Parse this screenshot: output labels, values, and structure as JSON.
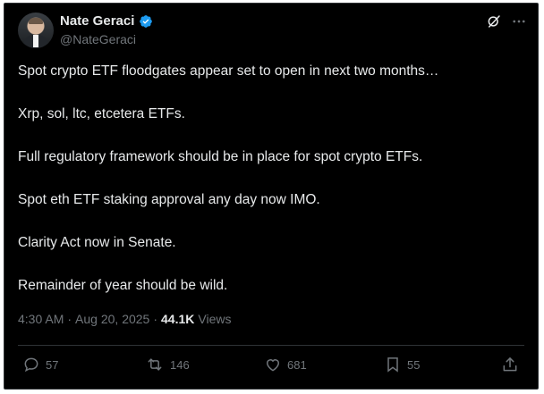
{
  "author": {
    "name": "Nate Geraci",
    "handle": "@NateGeraci"
  },
  "tweet": {
    "lines": [
      "Spot crypto ETF floodgates appear set to open in next two months…",
      "Xrp, sol, ltc, etcetera ETFs.",
      "Full regulatory framework should be in place for spot crypto ETFs.",
      "Spot eth ETF staking approval any day now IMO.",
      "Clarity Act now in Senate.",
      "Remainder of year should be wild."
    ],
    "time": "4:30 AM",
    "separator": "·",
    "date": "Aug 20, 2025",
    "views_count": "44.1K",
    "views_label": "Views"
  },
  "actions": {
    "replies": "57",
    "reposts": "146",
    "likes": "681",
    "bookmarks": "55"
  },
  "colors": {
    "background": "#000000",
    "text": "#e7e9ea",
    "muted": "#71767b",
    "verified": "#1d9bf0",
    "border": "#2f3336"
  },
  "icons": [
    "verified-badge-icon",
    "grok-icon",
    "more-icon",
    "reply-icon",
    "repost-icon",
    "like-icon",
    "bookmark-icon",
    "share-icon"
  ]
}
